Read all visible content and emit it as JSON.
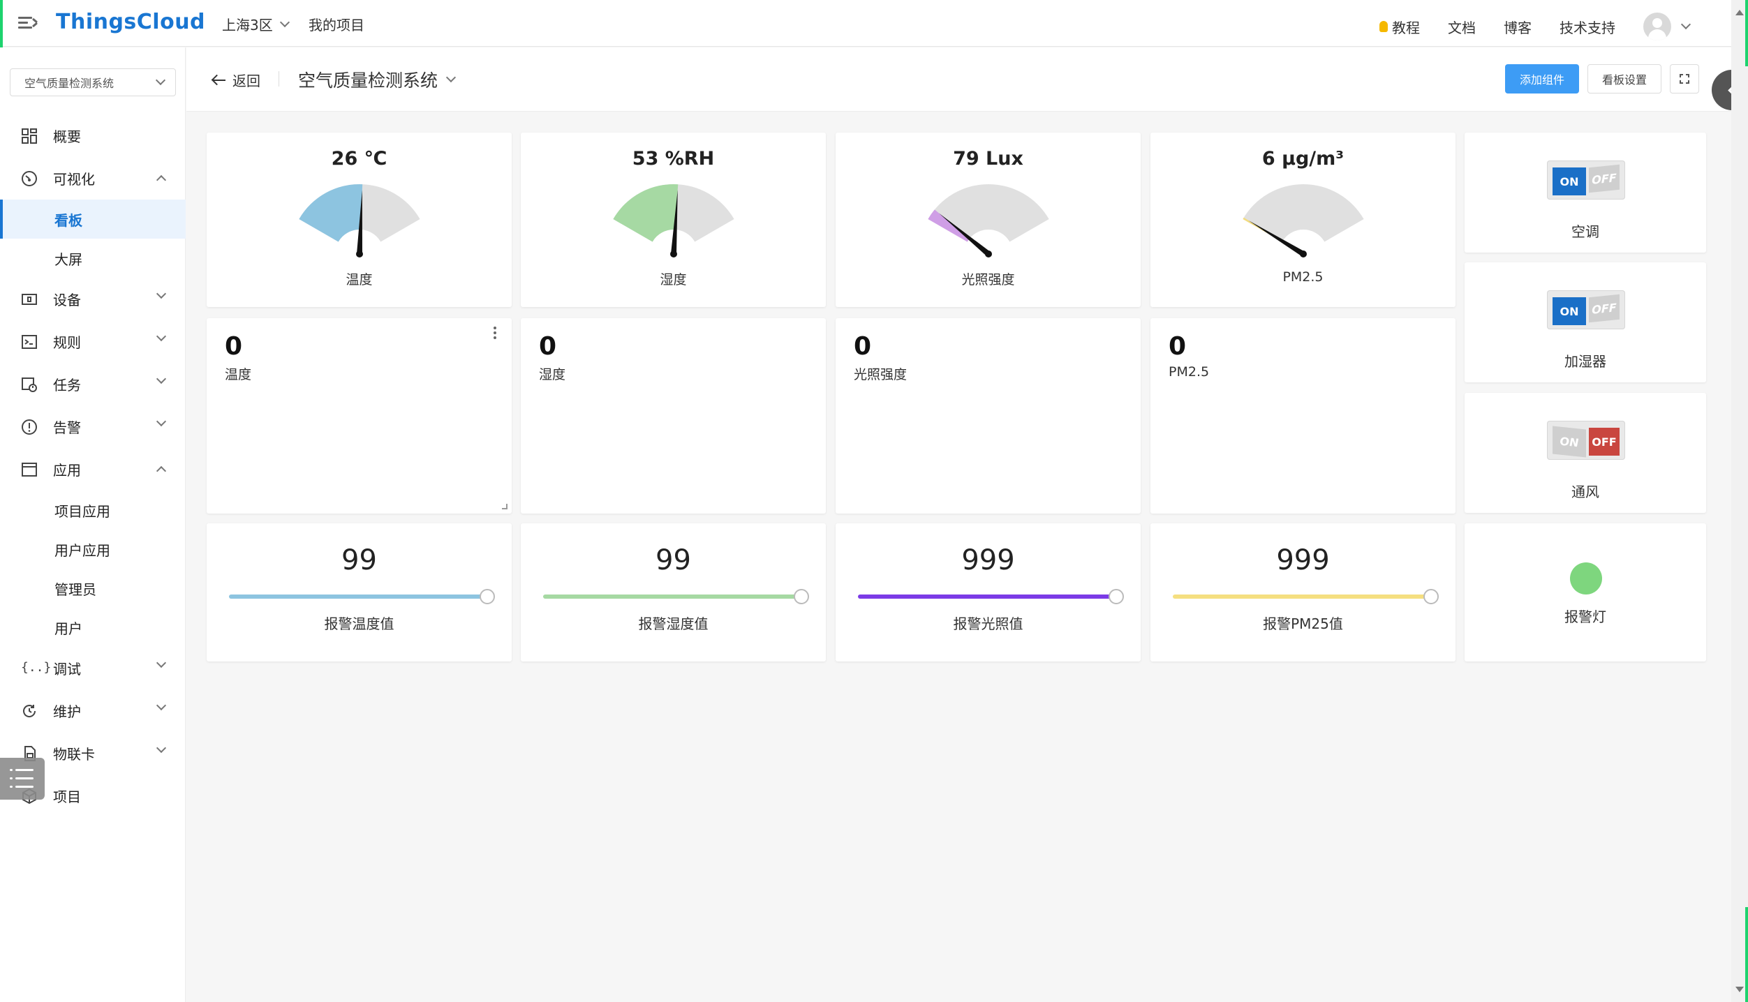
{
  "header": {
    "logo": "ThingsCloud",
    "region": "上海3区",
    "my_projects": "我的项目",
    "links": [
      "教程",
      "文档",
      "博客",
      "技术支持"
    ]
  },
  "sidebar": {
    "project_select": "空气质量检测系统",
    "items": [
      {
        "label": "概要",
        "icon": "grid-icon"
      },
      {
        "label": "可视化",
        "icon": "dashboard-icon",
        "expanded": true
      },
      {
        "label": "看板",
        "sub": true,
        "active": true
      },
      {
        "label": "大屏",
        "sub": true
      },
      {
        "label": "设备",
        "icon": "device-icon"
      },
      {
        "label": "规则",
        "icon": "rule-icon"
      },
      {
        "label": "任务",
        "icon": "task-icon"
      },
      {
        "label": "告警",
        "icon": "alert-icon"
      },
      {
        "label": "应用",
        "icon": "app-icon",
        "expanded": true
      },
      {
        "label": "项目应用",
        "sub": true
      },
      {
        "label": "用户应用",
        "sub": true
      },
      {
        "label": "管理员",
        "sub": true
      },
      {
        "label": "用户",
        "sub": true
      },
      {
        "label": "调试",
        "icon": "debug-icon"
      },
      {
        "label": "维护",
        "icon": "maintain-icon"
      },
      {
        "label": "物联卡",
        "icon": "simcard-icon"
      },
      {
        "label": "项目",
        "icon": "project-icon"
      }
    ]
  },
  "toolbar": {
    "back": "返回",
    "board_title": "空气质量检测系统",
    "add_widget": "添加组件",
    "board_settings": "看板设置"
  },
  "gauges": [
    {
      "display": "26 ℃",
      "label": "温度",
      "value": 26,
      "min": 0,
      "max": 50,
      "color": "#8dc4e0"
    },
    {
      "display": "53 %RH",
      "label": "湿度",
      "value": 53,
      "min": 0,
      "max": 100,
      "color": "#a6d9a3"
    },
    {
      "display": "79 Lux",
      "label": "光照强度",
      "value": 79,
      "min": 0,
      "max": 1000,
      "color": "#cf9ee6"
    },
    {
      "display": "6 μg/m³",
      "label": "PM2.5",
      "value": 6,
      "min": 0,
      "max": 500,
      "color": "#f2dc80"
    }
  ],
  "numbers": [
    {
      "value": "0",
      "label": "温度"
    },
    {
      "value": "0",
      "label": "湿度"
    },
    {
      "value": "0",
      "label": "光照强度"
    },
    {
      "value": "0",
      "label": "PM2.5"
    }
  ],
  "sliders": [
    {
      "value": "99",
      "label": "报警温度值",
      "fraction": 1.0,
      "color": "#8dc4e0"
    },
    {
      "value": "99",
      "label": "报警湿度值",
      "fraction": 1.0,
      "color": "#a6d9a3"
    },
    {
      "value": "999",
      "label": "报警光照值",
      "fraction": 1.0,
      "color": "#7b3be6"
    },
    {
      "value": "999",
      "label": "报警PM25值",
      "fraction": 1.0,
      "color": "#f5df80"
    }
  ],
  "switches": [
    {
      "label": "空调",
      "state": "on",
      "on_text": "ON",
      "off_text": "OFF"
    },
    {
      "label": "加湿器",
      "state": "on",
      "on_text": "ON",
      "off_text": "OFF"
    },
    {
      "label": "通风",
      "state": "off",
      "on_text": "ON",
      "off_text": "OFF"
    }
  ],
  "lamp": {
    "label": "报警灯",
    "color": "#7ed67e"
  }
}
